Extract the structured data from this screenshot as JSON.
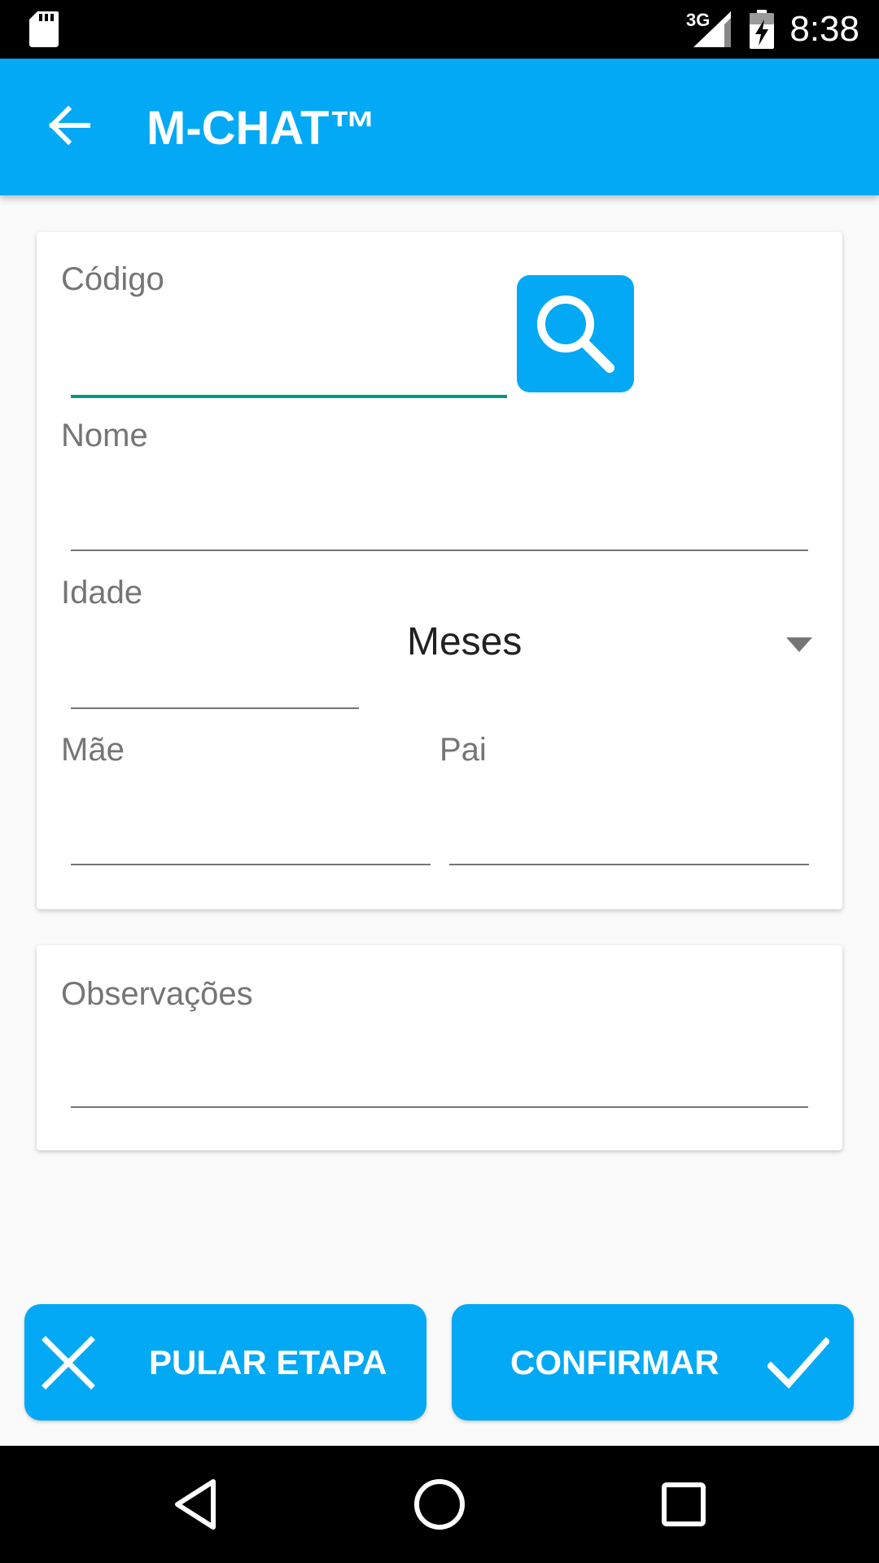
{
  "status_bar": {
    "network": "3G",
    "time": "8:38",
    "icons": [
      "sd-card-icon",
      "signal-icon",
      "battery-charging-icon"
    ]
  },
  "app_bar": {
    "title": "M-CHAT™",
    "back_icon": "arrow-back-icon"
  },
  "form": {
    "codigo": {
      "label": "Código",
      "value": ""
    },
    "search_icon": "search-icon",
    "nome": {
      "label": "Nome",
      "value": ""
    },
    "idade": {
      "label": "Idade",
      "value": ""
    },
    "unit_select": {
      "selected": "Meses",
      "icon": "dropdown-arrow-icon"
    },
    "mae": {
      "label": "Mãe",
      "value": ""
    },
    "pai": {
      "label": "Pai",
      "value": ""
    }
  },
  "notes": {
    "observacoes": {
      "label": "Observações",
      "value": ""
    }
  },
  "actions": {
    "skip_label": "PULAR ETAPA",
    "skip_icon": "close-icon",
    "confirm_label": "CONFIRMAR",
    "confirm_icon": "check-icon"
  },
  "nav_bar": {
    "icons": [
      "nav-back-icon",
      "nav-home-icon",
      "nav-recents-icon"
    ]
  },
  "colors": {
    "primary": "#03a9f4",
    "focus_underline": "#009688",
    "label": "#757575",
    "text": "#212121",
    "background": "#fafafa"
  }
}
